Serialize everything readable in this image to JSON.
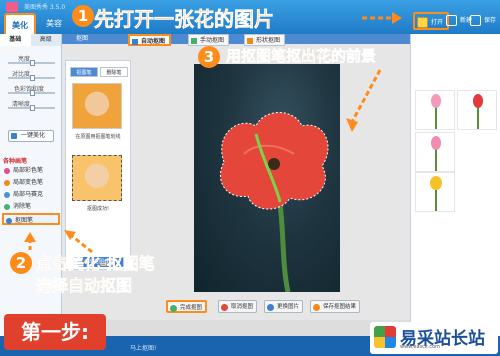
{
  "app": {
    "title": "美图秀秀 3.5.0"
  },
  "top_tabs": [
    {
      "label": "美化",
      "active": true
    },
    {
      "label": "美容",
      "active": false
    }
  ],
  "toolbar": {
    "open_label": "打开",
    "new_label": "新建",
    "save_label": "保存与分享"
  },
  "left_panel": {
    "subtabs": [
      "基础",
      "高级"
    ],
    "sliders": [
      {
        "label": "亮度",
        "value": 0.5
      },
      {
        "label": "对比度",
        "value": 0.5
      },
      {
        "label": "色彩饱和度",
        "value": 0.5
      },
      {
        "label": "清晰度",
        "value": 0.5
      }
    ],
    "one_key_label": "一键美化",
    "section_title": "各种画笔",
    "tools": [
      {
        "label": "局部彩色笔",
        "color": "#e94b8a"
      },
      {
        "label": "局部变色笔",
        "color": "#f08a1a"
      },
      {
        "label": "局部马赛克",
        "color": "#4a90d9"
      },
      {
        "label": "消除笔",
        "color": "#44b06c"
      },
      {
        "label": "抠图笔",
        "color": "#3d7fd0",
        "active": true
      }
    ]
  },
  "cutout_dialog": {
    "title": "抠图",
    "modes": [
      {
        "label": "自动抠图",
        "active": true
      },
      {
        "label": "手动抠图",
        "active": false
      },
      {
        "label": "形状抠图",
        "active": false
      }
    ],
    "mini_tabs": [
      "抠图笔",
      "删除笔"
    ],
    "original_caption": "在原图用抠图笔划线",
    "result_caption": "抠图成功!",
    "auto_button": "自动抠图教程",
    "bottom_buttons": [
      "完成抠图",
      "取消抠图",
      "更换图片",
      "保存抠图结果"
    ]
  },
  "annotations": {
    "step1_badge": "1",
    "step1_text": "先打开一张花的图片",
    "step3_badge": "3",
    "step3_text": "用抠图笔抠出花的前景",
    "step2_badge": "2",
    "step2_line1": "点击美化-抠图笔",
    "step2_line2": "选择自动抠图",
    "step_label": "第一步:"
  },
  "status": {
    "text": "马上抠图!"
  },
  "watermark": {
    "site": "易采站长站",
    "url": "www.easck.com"
  },
  "colors": {
    "accent": "#ff8c1a",
    "brand_blue": "#1f7bc6",
    "flower_red": "#e4463a"
  }
}
